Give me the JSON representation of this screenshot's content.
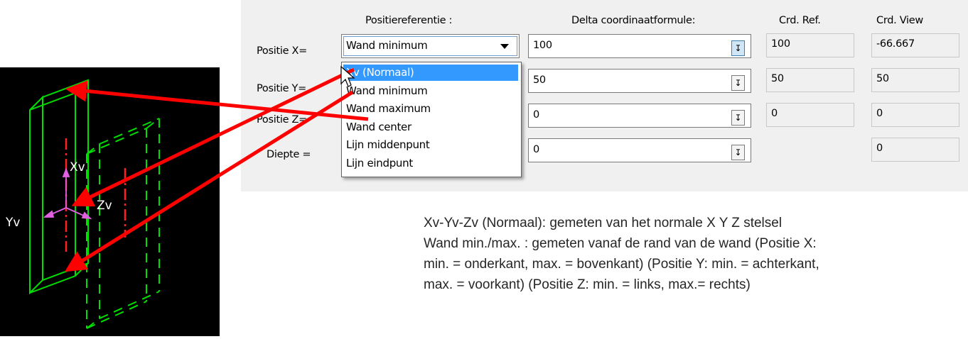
{
  "dialog": {
    "headers": {
      "position_reference": "Positiereferentie :",
      "delta_formula": "Delta coordinaatformule:",
      "crd_ref": "Crd. Ref.",
      "crd_view": "Crd. View"
    },
    "rows": [
      {
        "label": "Positie X=",
        "delta": "100",
        "crd_ref": "100",
        "crd_view": "-66.667"
      },
      {
        "label": "Positie Y=",
        "delta": "50",
        "crd_ref": "50",
        "crd_view": "50"
      },
      {
        "label": "Positie Z=",
        "delta": "0",
        "crd_ref": "0",
        "crd_view": "0"
      },
      {
        "label": "Diepte =",
        "delta": "0",
        "crd_ref": "",
        "crd_view": "0"
      }
    ],
    "combo_value": "Wand minimum",
    "dropdown_options": [
      "Xv (Normaal)",
      "Wand minimum",
      "Wand maximum",
      "Wand center",
      "Lijn middenpunt",
      "Lijn eindpunt"
    ],
    "dropdown_selected_index": 0
  },
  "drawing": {
    "axis_labels": {
      "x": "Xv",
      "y": "Yv",
      "z": "Zv"
    },
    "colors": {
      "background": "#000000",
      "wall": "#00e000",
      "axis": "#e060e0",
      "centerline": "#ff2020"
    }
  },
  "annotation_color": "#ff0000",
  "caption": {
    "line1": "Xv-Yv-Zv (Normaal): gemeten van het normale X Y Z stelsel",
    "line2": "Wand min./max. : gemeten vanaf de rand van de wand (Positie X:",
    "line3": "min. = onderkant, max. = bovenkant) (Positie Y: min. = achterkant,",
    "line4": "max. = voorkant) (Positie Z: min. = links, max.= rechts)"
  }
}
